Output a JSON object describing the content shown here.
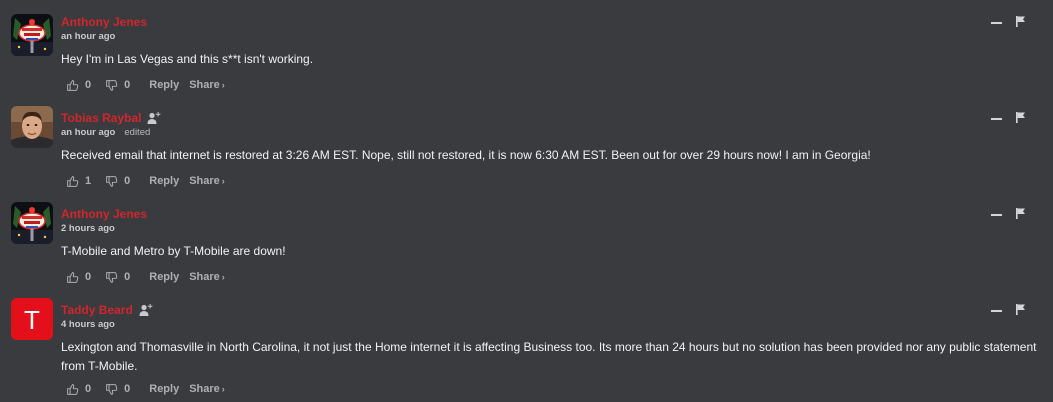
{
  "comments": [
    {
      "author": "Anthony Jenes",
      "time": "an hour ago",
      "edited": "",
      "text": "Hey I'm in Las Vegas and this s**t isn't working.",
      "upvotes": "0",
      "downvotes": "0",
      "reply_label": "Reply",
      "share_label": "Share",
      "avatar_icon": "las-vegas-sign-icon"
    },
    {
      "author": "Tobias Raybal",
      "time": "an hour ago",
      "edited": "edited",
      "text": "Received email that internet is restored at 3:26 AM EST. Nope, still not restored, it is now 6:30 AM EST. Been out for over 29 hours now! I am in Georgia!",
      "upvotes": "1",
      "downvotes": "0",
      "reply_label": "Reply",
      "share_label": "Share",
      "avatar_icon": "user-photo-icon"
    },
    {
      "author": "Anthony Jenes",
      "time": "2 hours ago",
      "edited": "",
      "text": "T-Mobile and Metro by T-Mobile are down!",
      "upvotes": "0",
      "downvotes": "0",
      "reply_label": "Reply",
      "share_label": "Share",
      "avatar_icon": "las-vegas-sign-icon"
    },
    {
      "author": "Taddy Beard",
      "time": "4 hours ago",
      "edited": "",
      "text": "Lexington and Thomasville in North Carolina, it not just the Home internet it is affecting Business too. Its more than 24 hours but no solution has been provided nor any public statement from T-Mobile.",
      "upvotes": "0",
      "downvotes": "0",
      "reply_label": "Reply",
      "share_label": "Share",
      "avatar_icon": "letter-t-avatar-icon",
      "avatar_letter": "T"
    }
  ],
  "colors": {
    "background": "#3a3b3f",
    "username": "#d0262c",
    "text": "#f2f2f4",
    "muted": "#aeb0b4",
    "avatar_red": "#e3101c"
  }
}
